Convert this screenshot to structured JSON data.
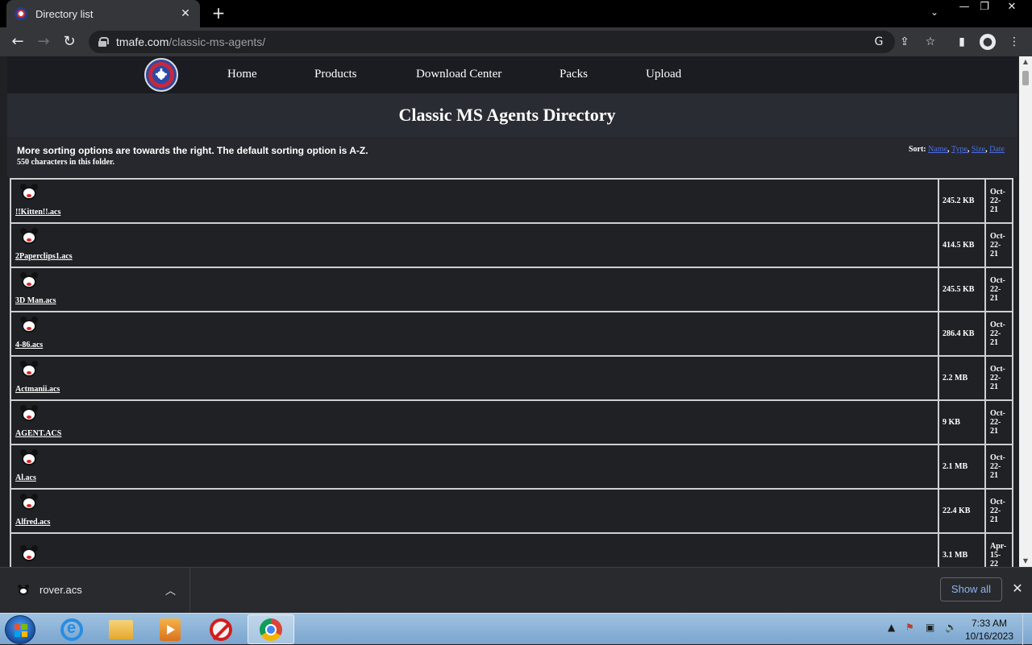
{
  "browser": {
    "tab_title": "Directory list",
    "tab_close": "✕",
    "new_tab": "+",
    "url_host": "tmafe.com",
    "url_path": "/classic-ms-agents/"
  },
  "site": {
    "nav": [
      "Home",
      "Products",
      "Download Center",
      "Packs",
      "Upload"
    ],
    "title": "Classic MS Agents Directory",
    "info_main": "More sorting options are towards the right. The default sorting option is A-Z.",
    "info_sub": "550 characters in this folder.",
    "sort_label": "Sort:",
    "sort_options": [
      "Name",
      "Type",
      "Size",
      "Date"
    ]
  },
  "files": [
    {
      "name": "!!Kitten!!.acs",
      "size": "245.2 KB",
      "date": [
        "Oct-",
        "22-",
        "21"
      ]
    },
    {
      "name": "2Paperclips1.acs",
      "size": "414.5 KB",
      "date": [
        "Oct-",
        "22-",
        "21"
      ]
    },
    {
      "name": "3D Man.acs",
      "size": "245.5 KB",
      "date": [
        "Oct-",
        "22-",
        "21"
      ]
    },
    {
      "name": "4-86.acs",
      "size": "286.4 KB",
      "date": [
        "Oct-",
        "22-",
        "21"
      ]
    },
    {
      "name": "Actmanii.acs",
      "size": "2.2 MB",
      "date": [
        "Oct-",
        "22-",
        "21"
      ]
    },
    {
      "name": "AGENT.ACS",
      "size": "9 KB",
      "date": [
        "Oct-",
        "22-",
        "21"
      ]
    },
    {
      "name": "Al.acs",
      "size": "2.1 MB",
      "date": [
        "Oct-",
        "22-",
        "21"
      ]
    },
    {
      "name": "Alfred.acs",
      "size": "22.4 KB",
      "date": [
        "Oct-",
        "22-",
        "21"
      ]
    },
    {
      "name": "",
      "size": "3.1 MB",
      "date": [
        "Apr-",
        "15-",
        "22"
      ]
    }
  ],
  "downloads": {
    "file_name": "rover.acs",
    "show_all": "Show all"
  },
  "taskbar": {
    "time": "7:33 AM",
    "date": "10/16/2023"
  }
}
